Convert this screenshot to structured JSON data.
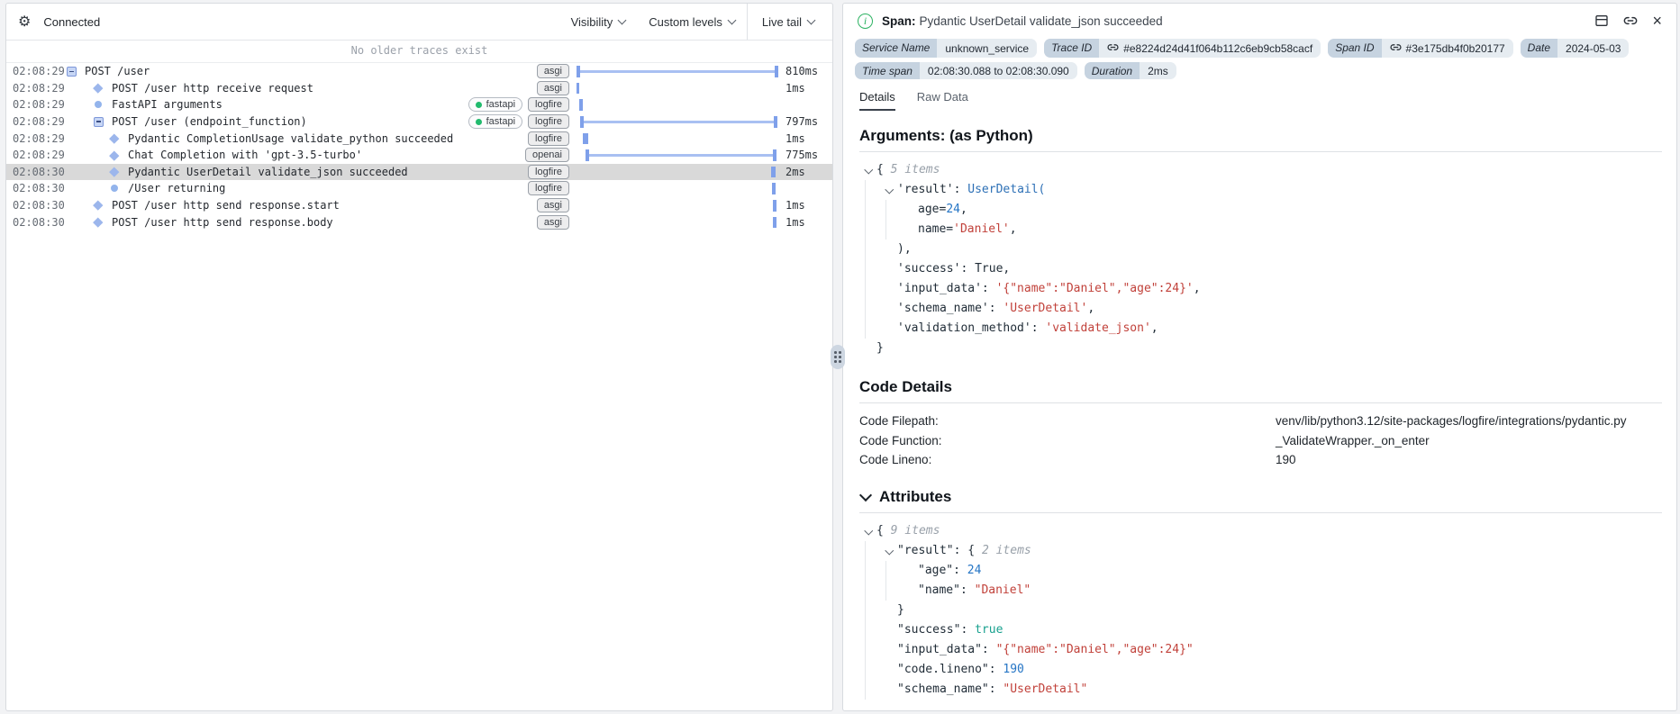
{
  "left_panel": {
    "header": {
      "connected": "Connected",
      "menus": [
        {
          "label": "Visibility"
        },
        {
          "label": "Custom levels"
        }
      ],
      "live_tail": "Live tail"
    },
    "notice": "No older traces exist",
    "rows": [
      {
        "time": "02:08:29",
        "icon": "collapse",
        "indent": 0,
        "name": "POST /user",
        "tags": [
          "asgi"
        ],
        "bar": {
          "kind": "span",
          "start": 0,
          "end": 100
        },
        "duration": "810ms",
        "selected": false
      },
      {
        "time": "02:08:29",
        "icon": "diamond",
        "indent": 1,
        "name": "POST /user http receive request",
        "tags": [
          "asgi"
        ],
        "bar": {
          "kind": "point",
          "pos": 0,
          "w": 3
        },
        "duration": "1ms",
        "selected": false
      },
      {
        "time": "02:08:29",
        "icon": "circle",
        "indent": 1,
        "name": "FastAPI arguments",
        "tags": [
          "fastapi",
          "logfire"
        ],
        "bar": {
          "kind": "point",
          "pos": 1.5,
          "w": 4
        },
        "duration": "",
        "selected": false
      },
      {
        "time": "02:08:29",
        "icon": "collapse",
        "indent": 1,
        "name": "POST /user (endpoint_function)",
        "tags": [
          "fastapi",
          "logfire"
        ],
        "bar": {
          "kind": "span",
          "start": 2,
          "end": 99.5
        },
        "duration": "797ms",
        "selected": false
      },
      {
        "time": "02:08:29",
        "icon": "diamond",
        "indent": 2,
        "name": "Pydantic CompletionUsage validate_python succeeded",
        "tags": [
          "logfire"
        ],
        "bar": {
          "kind": "point",
          "pos": 3.2,
          "w": 6
        },
        "duration": "1ms",
        "selected": false
      },
      {
        "time": "02:08:29",
        "icon": "diamond",
        "indent": 2,
        "name": "Chat Completion with 'gpt-3.5-turbo'",
        "tags": [
          "openai"
        ],
        "bar": {
          "kind": "span",
          "start": 4.5,
          "end": 99
        },
        "duration": "775ms",
        "selected": false
      },
      {
        "time": "02:08:30",
        "icon": "diamond",
        "indent": 2,
        "name": "Pydantic UserDetail validate_json succeeded",
        "tags": [
          "logfire"
        ],
        "bar": {
          "kind": "point",
          "pos": 98.6,
          "w": 5
        },
        "duration": "2ms",
        "selected": true
      },
      {
        "time": "02:08:30",
        "icon": "circle",
        "indent": 2,
        "name": "/User returning",
        "tags": [
          "logfire"
        ],
        "bar": {
          "kind": "point",
          "pos": 98.6,
          "w": 4
        },
        "duration": "",
        "selected": false
      },
      {
        "time": "02:08:30",
        "icon": "diamond",
        "indent": 1,
        "name": "POST /user http send response.start",
        "tags": [
          "asgi"
        ],
        "bar": {
          "kind": "point",
          "pos": 99.2,
          "w": 4
        },
        "duration": "1ms",
        "selected": false
      },
      {
        "time": "02:08:30",
        "icon": "diamond",
        "indent": 1,
        "name": "POST /user http send response.body",
        "tags": [
          "asgi"
        ],
        "bar": {
          "kind": "point",
          "pos": 99.2,
          "w": 4
        },
        "duration": "1ms",
        "selected": false
      }
    ]
  },
  "right_panel": {
    "title": {
      "prefix": "Span:",
      "name": "Pydantic UserDetail validate_json succeeded"
    },
    "badges": [
      [
        {
          "label": "Service Name",
          "value": "unknown_service",
          "link": false
        },
        {
          "label": "Trace ID",
          "value": "#e8224d24d41f064b112c6eb9cb58cacf",
          "link": true
        },
        {
          "label": "Span ID",
          "value": "#3e175db4f0b20177",
          "link": true
        },
        {
          "label": "Date",
          "value": "2024-05-03",
          "link": false
        }
      ],
      [
        {
          "label": "Time span",
          "value": "02:08:30.088 to 02:08:30.090",
          "link": false
        },
        {
          "label": "Duration",
          "value": "2ms",
          "link": false
        }
      ]
    ],
    "tabs": [
      "Details",
      "Raw Data"
    ],
    "active_tab": "Details",
    "arguments": {
      "heading": "Arguments: (as Python)",
      "lines": [
        {
          "indent": 0,
          "chev": true,
          "segs": [
            [
              "{ ",
              "p"
            ],
            [
              "5 items",
              "meta"
            ]
          ]
        },
        {
          "indent": 1,
          "chev": true,
          "segs": [
            [
              "'result'",
              "key"
            ],
            [
              ": ",
              "p"
            ],
            [
              "UserDetail(",
              "cls"
            ]
          ]
        },
        {
          "indent": 2,
          "chev": false,
          "segs": [
            [
              "age=",
              "p"
            ],
            [
              "24",
              "num"
            ],
            [
              ",",
              "p"
            ]
          ]
        },
        {
          "indent": 2,
          "chev": false,
          "segs": [
            [
              "name=",
              "p"
            ],
            [
              "'Daniel'",
              "str"
            ],
            [
              ",",
              "p"
            ]
          ]
        },
        {
          "indent": 1,
          "chev": false,
          "segs": [
            [
              "),",
              "p"
            ]
          ]
        },
        {
          "indent": 1,
          "chev": false,
          "segs": [
            [
              "'success'",
              "key"
            ],
            [
              ": ",
              "p"
            ],
            [
              "True,",
              "p"
            ]
          ]
        },
        {
          "indent": 1,
          "chev": false,
          "segs": [
            [
              "'input_data'",
              "key"
            ],
            [
              ": ",
              "p"
            ],
            [
              "'{\"name\":\"Daniel\",\"age\":24}'",
              "str"
            ],
            [
              ",",
              "p"
            ]
          ]
        },
        {
          "indent": 1,
          "chev": false,
          "segs": [
            [
              "'schema_name'",
              "key"
            ],
            [
              ": ",
              "p"
            ],
            [
              "'UserDetail'",
              "str"
            ],
            [
              ",",
              "p"
            ]
          ]
        },
        {
          "indent": 1,
          "chev": false,
          "segs": [
            [
              "'validation_method'",
              "key"
            ],
            [
              ": ",
              "p"
            ],
            [
              "'validate_json'",
              "str"
            ],
            [
              ",",
              "p"
            ]
          ]
        },
        {
          "indent": 0,
          "chev": false,
          "segs": [
            [
              "}",
              "p"
            ]
          ]
        }
      ]
    },
    "code_details": {
      "heading": "Code Details",
      "rows": [
        {
          "label": "Code Filepath:",
          "value": "venv/lib/python3.12/site-packages/logfire/integrations/pydantic.py"
        },
        {
          "label": "Code Function:",
          "value": "_ValidateWrapper._on_enter"
        },
        {
          "label": "Code Lineno:",
          "value": "190"
        }
      ]
    },
    "attributes": {
      "heading": "Attributes",
      "lines": [
        {
          "indent": 0,
          "chev": true,
          "segs": [
            [
              "{ ",
              "p"
            ],
            [
              "9 items",
              "meta"
            ]
          ]
        },
        {
          "indent": 1,
          "chev": true,
          "segs": [
            [
              "\"result\"",
              "key"
            ],
            [
              ": ",
              "p"
            ],
            [
              "{ ",
              "p"
            ],
            [
              "2 items",
              "meta"
            ]
          ]
        },
        {
          "indent": 2,
          "chev": false,
          "segs": [
            [
              "\"age\"",
              "key"
            ],
            [
              ": ",
              "p"
            ],
            [
              "24",
              "num"
            ]
          ]
        },
        {
          "indent": 2,
          "chev": false,
          "segs": [
            [
              "\"name\"",
              "key"
            ],
            [
              ": ",
              "p"
            ],
            [
              "\"Daniel\"",
              "str"
            ]
          ]
        },
        {
          "indent": 1,
          "chev": false,
          "segs": [
            [
              "}",
              "p"
            ]
          ]
        },
        {
          "indent": 1,
          "chev": false,
          "segs": [
            [
              "\"success\"",
              "key"
            ],
            [
              ": ",
              "p"
            ],
            [
              "true",
              "bool"
            ]
          ]
        },
        {
          "indent": 1,
          "chev": false,
          "segs": [
            [
              "\"input_data\"",
              "key"
            ],
            [
              ": ",
              "p"
            ],
            [
              "\"{\"name\":\"Daniel\",\"age\":24}\"",
              "str"
            ]
          ]
        },
        {
          "indent": 1,
          "chev": false,
          "segs": [
            [
              "\"code.lineno\"",
              "key"
            ],
            [
              ": ",
              "p"
            ],
            [
              "190",
              "num"
            ]
          ]
        },
        {
          "indent": 1,
          "chev": false,
          "segs": [
            [
              "\"schema_name\"",
              "key"
            ],
            [
              ": ",
              "p"
            ],
            [
              "\"UserDetail\"",
              "str"
            ]
          ]
        }
      ]
    }
  }
}
